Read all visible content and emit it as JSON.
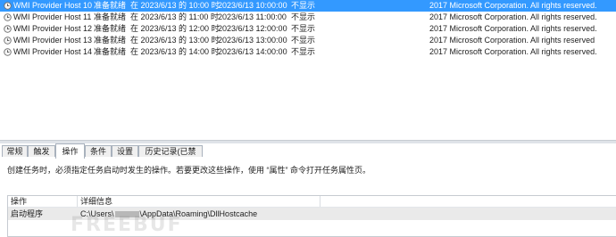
{
  "tasks": [
    {
      "name": "WMI Provider Host 10",
      "status": "准备就绪",
      "trigger": "在 2023/6/13 的 10:00 时",
      "next_run": "2023/6/13 10:00:00",
      "last_run": "不显示",
      "author": "2017 Microsoft Corporation. All rights reserved.",
      "selected": true
    },
    {
      "name": "WMI Provider Host 11",
      "status": "准备就绪",
      "trigger": "在 2023/6/13 的 11:00 时",
      "next_run": "2023/6/13 11:00:00",
      "last_run": "不显示",
      "author": "2017 Microsoft Corporation. All rights reserved."
    },
    {
      "name": "WMI Provider Host 12",
      "status": "准备就绪",
      "trigger": "在 2023/6/13 的 12:00 时",
      "next_run": "2023/6/13 12:00:00",
      "last_run": "不显示",
      "author": "2017 Microsoft Corporation. All rights reserved."
    },
    {
      "name": "WMI Provider Host 13",
      "status": "准备就绪",
      "trigger": "在 2023/6/13 的 13:00 时",
      "next_run": "2023/6/13 13:00:00",
      "last_run": "不显示",
      "author": "2017 Microsoft Corporation. All rights reserved"
    },
    {
      "name": "WMI Provider Host 14",
      "status": "准备就绪",
      "trigger": "在 2023/6/13 的 14:00 时",
      "next_run": "2023/6/13 14:00:00",
      "last_run": "不显示",
      "author": "2017 Microsoft Corporation. All rights reserved."
    }
  ],
  "task_icon": "clock-icon",
  "tabs": [
    {
      "label": "常规"
    },
    {
      "label": "触发器"
    },
    {
      "label": "操作",
      "active": true
    },
    {
      "label": "条件"
    },
    {
      "label": "设置"
    },
    {
      "label": "历史记录(已禁用)"
    }
  ],
  "actions_tab": {
    "description": "创建任务时，必须指定任务启动时发生的操作。若要更改这些操作，使用 “属性” 命令打开任务属性页。",
    "headers": {
      "action": "操作",
      "detail": "详细信息"
    },
    "rows": [
      {
        "action": "启动程序",
        "detail_prefix": "C:\\Users\\",
        "detail_suffix": "\\AppData\\Roaming\\DllHostcache"
      }
    ]
  },
  "watermark": "FREEBUF",
  "colors": {
    "selection": "#3399ff",
    "selected_text": "#ffffff",
    "row_highlight": "#eaeaea"
  }
}
